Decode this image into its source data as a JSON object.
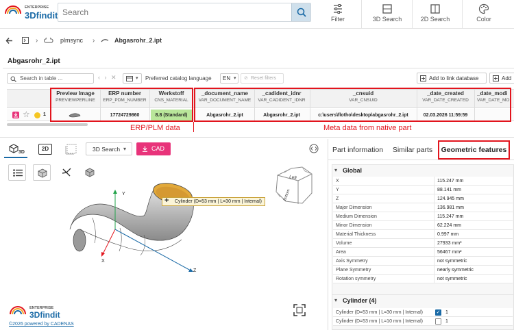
{
  "app": {
    "logo_top": "ENTERPRISE",
    "logo_main": "3Dfindit",
    "search_placeholder": "Search",
    "toolbar": [
      {
        "label": "Filter",
        "icon": "filter-icon"
      },
      {
        "label": "3D Search",
        "icon": "3d-search-icon"
      },
      {
        "label": "2D Search",
        "icon": "2d-search-icon"
      },
      {
        "label": "Color",
        "icon": "color-icon"
      }
    ]
  },
  "breadcrumb": {
    "items": [
      "plmsync",
      "Abgasrohr_2.ipt"
    ]
  },
  "document": {
    "title": "Abgasrohr_2.ipt"
  },
  "table_toolbar": {
    "search_placeholder": "Search in table ...",
    "catalog_language_label": "Preferred catalog language",
    "language": "EN",
    "reset_filters": "Reset filters",
    "add_to_link_db": "Add to link database",
    "add": "Add"
  },
  "table": {
    "columns": [
      {
        "title": "Preview Image",
        "var": "PREVIEWPERLINE"
      },
      {
        "title": "ERP number",
        "var": "ERP_PDM_NUMBER"
      },
      {
        "title": "Werkstoff",
        "var": "CNS_MATERIAL"
      },
      {
        "title": "_document_name",
        "var": "VAR_DOCUMENT_NAME"
      },
      {
        "title": "_cadident_idnr",
        "var": "VAR_CADIDENT_IDNR"
      },
      {
        "title": "_cnsuid",
        "var": "VAR_CNSUID"
      },
      {
        "title": "_date_created",
        "var": "VAR_DATE_CREATED"
      },
      {
        "title": "_date_modi",
        "var": "VAR_DATE_MO"
      }
    ],
    "row": {
      "index": "1",
      "erp_number": "17724729860",
      "material": "8.8 (Standard)",
      "document_name": "Abgasrohr_2.ipt",
      "cadident_idnr": "Abgasrohr_2.ipt",
      "cnsuid": "c:\\users\\flotho\\desktop\\abgasrohr_2.ipt",
      "date_created": "02.03.2026 11:59:59"
    }
  },
  "annotations": {
    "erp_label": "ERP/PLM data",
    "meta_label": "Meta data from native part"
  },
  "viewer": {
    "tab_3d": "3D",
    "tab_2d": "2D",
    "search_3d": "3D Search",
    "cad_button": "CAD",
    "tooltip": "Cylinder (D=53 mm | L=30 mm | Internal)",
    "axis_x": "X",
    "axis_y": "Y",
    "axis_z": "Z",
    "cube_face_left": "Left",
    "cube_face_bottom": "Bottom",
    "footer_logo_top": "ENTERPRISE",
    "footer_logo_main": "3Dfindit",
    "footer_copyright": "©2026 powered by CADENAS"
  },
  "right_panel": {
    "tabs": [
      "Part information",
      "Similar parts",
      "Geometric features"
    ],
    "active_tab": "Geometric features",
    "global_section": "Global",
    "global_rows": [
      {
        "label": "X",
        "value": "115.247 mm"
      },
      {
        "label": "Y",
        "value": "88.141 mm"
      },
      {
        "label": "Z",
        "value": "124.945 mm"
      },
      {
        "label": "Major Dimension",
        "value": "136.981 mm"
      },
      {
        "label": "Medium Dimension",
        "value": "115.247 mm"
      },
      {
        "label": "Minor Dimension",
        "value": "62.224 mm"
      },
      {
        "label": "Material Thickness",
        "value": "0.997 mm"
      },
      {
        "label": "Volume",
        "value": "27933 mm³"
      },
      {
        "label": "Area",
        "value": "56467 mm²"
      },
      {
        "label": "Axis Symmetry",
        "value": "not symmetric"
      },
      {
        "label": "Plane Symmetry",
        "value": "nearly symmetric"
      },
      {
        "label": "Rotation symmetry",
        "value": "not symmetric"
      }
    ],
    "cylinder_section": "Cylinder (4)",
    "cylinder_rows": [
      {
        "label": "Cylinder (D=53 mm | L=30 mm | Internal)",
        "count": "1",
        "checked": true
      },
      {
        "label": "Cylinder (D=53 mm | L=10 mm | Internal)",
        "count": "1",
        "checked": false
      }
    ]
  },
  "colors": {
    "accent_red": "#e2141d",
    "brand_blue": "#1a6aa6",
    "cad_pink": "#e8337a",
    "material_green": "#b9e69a",
    "active_tab_border": "#e2141d"
  }
}
